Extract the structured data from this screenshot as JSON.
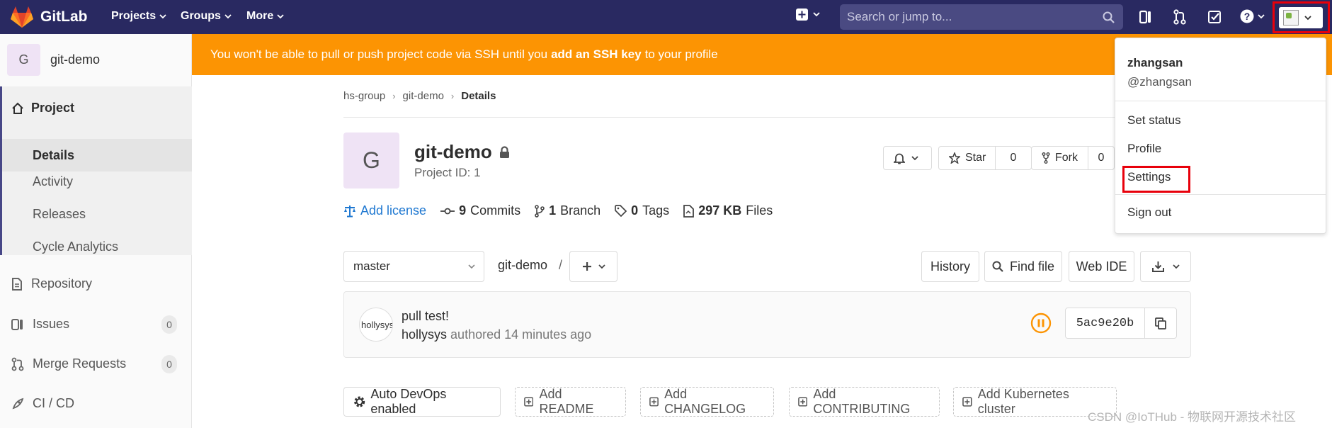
{
  "navbar": {
    "brand": "GitLab",
    "menus": [
      "Projects",
      "Groups",
      "More"
    ],
    "search_placeholder": "Search or jump to...",
    "colors": {
      "background": "#292961",
      "logo": "#fc6d26"
    }
  },
  "sidebar": {
    "project_initial": "G",
    "project_name": "git-demo",
    "section_project": "Project",
    "project_sub": [
      "Details",
      "Activity",
      "Releases",
      "Cycle Analytics"
    ],
    "repository": "Repository",
    "issues": {
      "label": "Issues",
      "count": "0"
    },
    "merge_requests": {
      "label": "Merge Requests",
      "count": "0"
    },
    "ci_cd": "CI / CD"
  },
  "alert": {
    "text_before": "You won't be able to pull or push project code via SSH until you",
    "strong": "add an SSH key",
    "text_after": "to your profile",
    "color": "#fc9403"
  },
  "breadcrumb": [
    "hs-group",
    "git-demo",
    "Details"
  ],
  "project": {
    "initial": "G",
    "title": "git-demo",
    "id_text": "Project ID: 1",
    "star_label": "Star",
    "star_count": "0",
    "fork_label": "Fork",
    "fork_count": "0"
  },
  "stats": {
    "license": "Add license",
    "commits_num": "9",
    "commits_label": "Commits",
    "branch_num": "1",
    "branch_label": "Branch",
    "tags_num": "0",
    "tags_label": "Tags",
    "files_size": "297 KB",
    "files_label": "Files"
  },
  "repo": {
    "branch": "master",
    "path": "git-demo",
    "slash": "/",
    "history": "History",
    "find_file": "Find file",
    "web_ide": "Web IDE"
  },
  "commit": {
    "avatar_alt": "hollysys",
    "title": "pull test!",
    "author": "hollysys",
    "meta": "authored 14 minutes ago",
    "sha": "5ac9e20b",
    "pipeline_color": "#fc9403"
  },
  "actions": {
    "auto_devops": "Auto DevOps enabled",
    "add_readme": "Add README",
    "add_changelog": "Add CHANGELOG",
    "add_contributing": "Add CONTRIBUTING",
    "add_k8s": "Add Kubernetes cluster"
  },
  "user_menu": {
    "name": "zhangsan",
    "username": "@zhangsan",
    "items": [
      "Set status",
      "Profile",
      "Settings",
      "Sign out"
    ],
    "highlight_color": "#e8000b"
  },
  "watermark": "CSDN @IoTHub - 物联网开源技术社区"
}
